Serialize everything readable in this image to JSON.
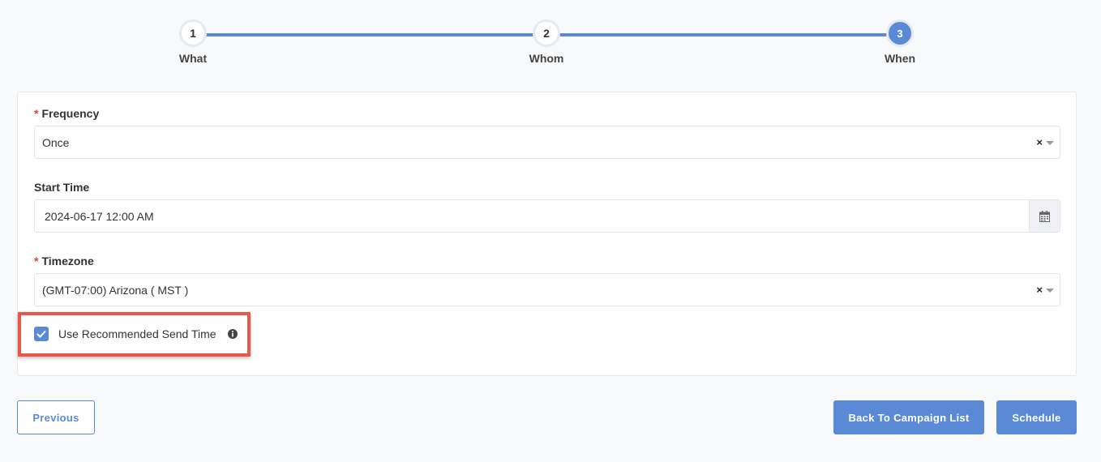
{
  "stepper": {
    "steps": [
      {
        "number": "1",
        "label": "What"
      },
      {
        "number": "2",
        "label": "Whom"
      },
      {
        "number": "3",
        "label": "When"
      }
    ]
  },
  "form": {
    "frequency": {
      "required_mark": "*",
      "label": "Frequency",
      "value": "Once",
      "clear": "×"
    },
    "start_time": {
      "label": "Start Time",
      "value": "2024-06-17 12:00 AM"
    },
    "timezone": {
      "required_mark": "*",
      "label": "Timezone",
      "value": "(GMT-07:00) Arizona ( MST )",
      "clear": "×"
    },
    "recommended": {
      "label": "Use Recommended Send Time",
      "checked": true
    }
  },
  "buttons": {
    "previous": "Previous",
    "back": "Back To Campaign List",
    "schedule": "Schedule"
  },
  "colors": {
    "accent": "#5a8ad6",
    "required": "#e0413a",
    "highlight": "#e8574a"
  }
}
